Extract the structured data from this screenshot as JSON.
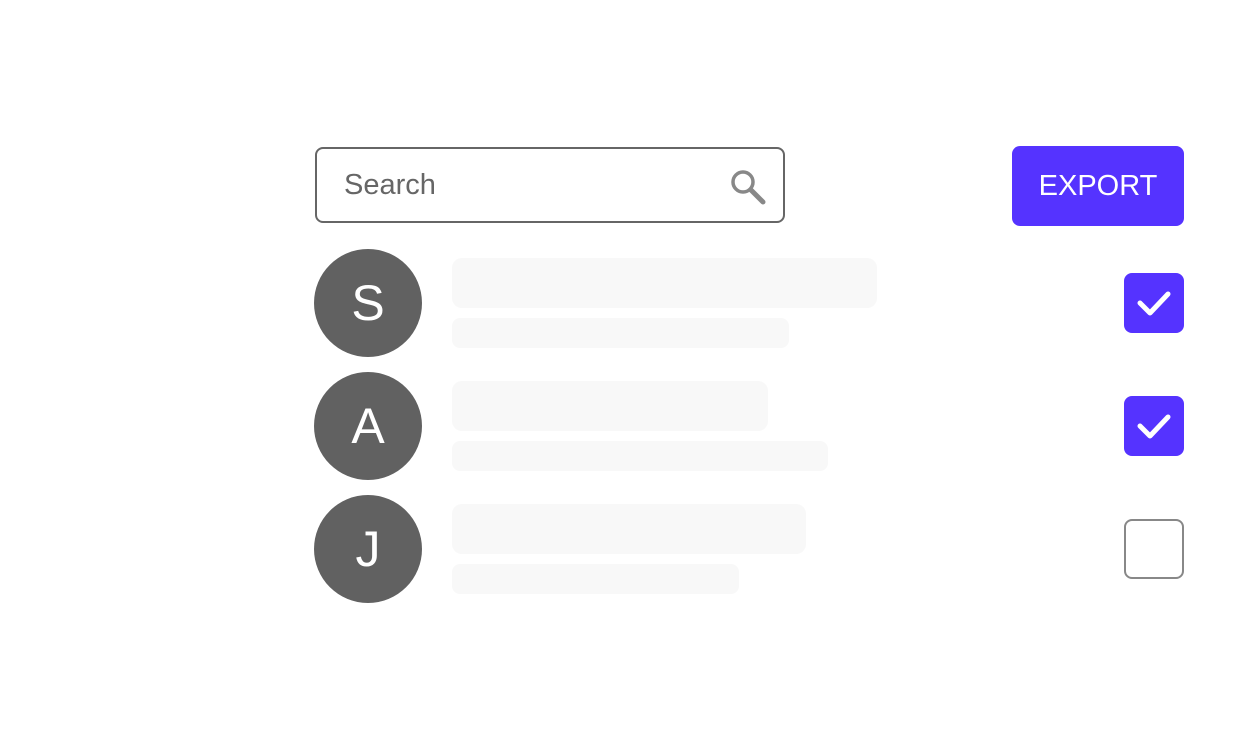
{
  "search": {
    "placeholder": "Search",
    "icon": "search-icon"
  },
  "toolbar": {
    "export_label": "EXPORT"
  },
  "colors": {
    "accent": "#5533ff",
    "avatar": "#616161",
    "skeleton": "#f8f8f8",
    "border": "#666666"
  },
  "list": {
    "items": [
      {
        "initial": "S",
        "checked": true
      },
      {
        "initial": "A",
        "checked": true
      },
      {
        "initial": "J",
        "checked": false
      }
    ]
  }
}
